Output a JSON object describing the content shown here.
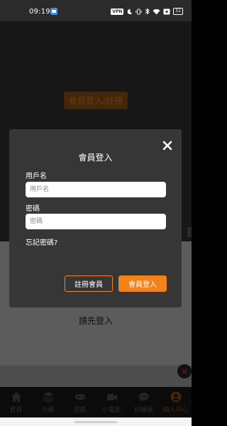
{
  "status_bar": {
    "time": "09:19",
    "vpn": "VPN",
    "battery": "51",
    "icons": [
      "app-notification-icon",
      "vpn-icon",
      "moon-icon",
      "vibrate-icon",
      "bluetooth-icon",
      "wifi-icon",
      "battery-saver-icon",
      "battery-icon"
    ]
  },
  "page": {
    "login_register_button": "會員登入/註冊",
    "please_login": "請先登入"
  },
  "modal": {
    "title": "會員登入",
    "username_label": "用戶名",
    "username_placeholder": "用戶名",
    "username_value": "",
    "password_label": "密碼",
    "password_placeholder": "密碼",
    "password_value": "",
    "forgot_password": "忘記密碼?",
    "register_button": "註冊會員",
    "submit_button": "會員登入",
    "close_icon": "close-icon"
  },
  "bottom_nav": {
    "items": [
      {
        "label": "首頁",
        "icon": "home-icon"
      },
      {
        "label": "分類",
        "icon": "layers-icon"
      },
      {
        "label": "遊戲",
        "icon": "gamepad-icon"
      },
      {
        "label": "小電影",
        "icon": "video-camera-icon"
      },
      {
        "label": "討論區",
        "icon": "chat-bubble-icon"
      },
      {
        "label": "個人中心",
        "icon": "user-icon"
      }
    ],
    "active_index": 5
  },
  "colors": {
    "accent": "#f2831b",
    "modal_background": "#363636",
    "status_bar": "#2b2b2b"
  }
}
